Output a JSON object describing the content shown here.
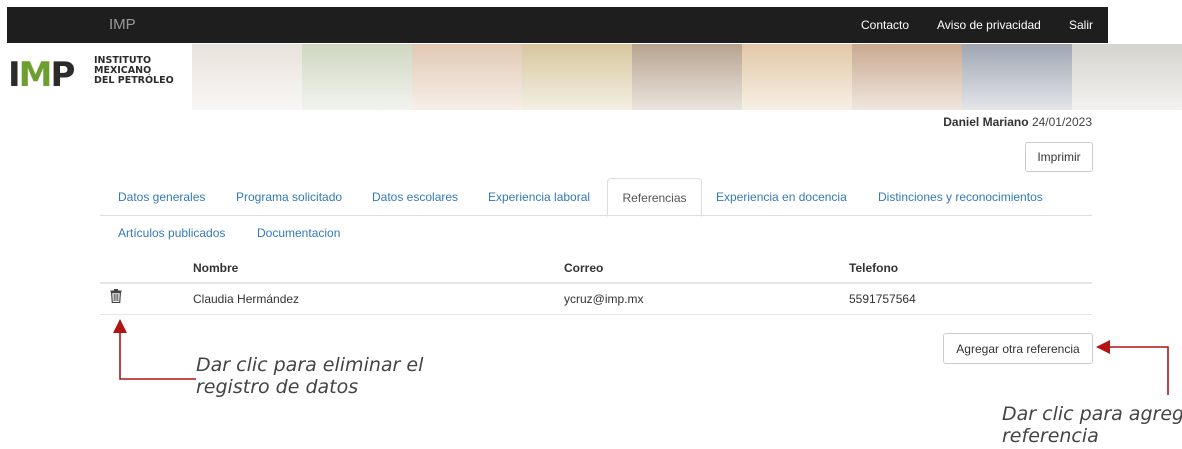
{
  "navbar": {
    "brand": "IMP",
    "links": [
      "Contacto",
      "Aviso de privacidad",
      "Salir"
    ]
  },
  "header": {
    "logo_mark": "IMP",
    "logo_lines": [
      "INSTITUTO",
      "MEXICANO",
      "DEL PETRÓLEO"
    ],
    "banner_colors": [
      "#e9e2dc",
      "#cfd7c2",
      "#e1c8b3",
      "#d6c79e",
      "#b7a38f",
      "#e2c8a7",
      "#c9a98f",
      "#9fa6b2",
      "#d5d3cd"
    ]
  },
  "user": {
    "name": "Daniel Mariano",
    "date": "24/01/2023"
  },
  "print_label": "Imprimir",
  "tabs": [
    "Datos generales",
    "Programa solicitado",
    "Datos escolares",
    "Experiencia laboral",
    "Referencias",
    "Experiencia en docencia",
    "Distinciones y reconocimientos",
    "Artículos publicados",
    "Documentacion"
  ],
  "table": {
    "headers": [
      "Nombre",
      "Correo",
      "Telefono"
    ],
    "rows": [
      {
        "nombre": "Claudia Hermández",
        "correo": "ycruz@imp.mx",
        "telefono": "5591757564"
      }
    ]
  },
  "add_label": "Agregar otra referencia",
  "annotations": {
    "delete": [
      "Dar clic para eliminar el",
      "registro de datos"
    ],
    "add": [
      "Dar clic para agreg",
      "referencia"
    ]
  },
  "colors": {
    "navbar": "#1e1e1e",
    "link": "#337ab7",
    "arrow": "#b01414",
    "logo_accent": "#6d9f2e"
  }
}
